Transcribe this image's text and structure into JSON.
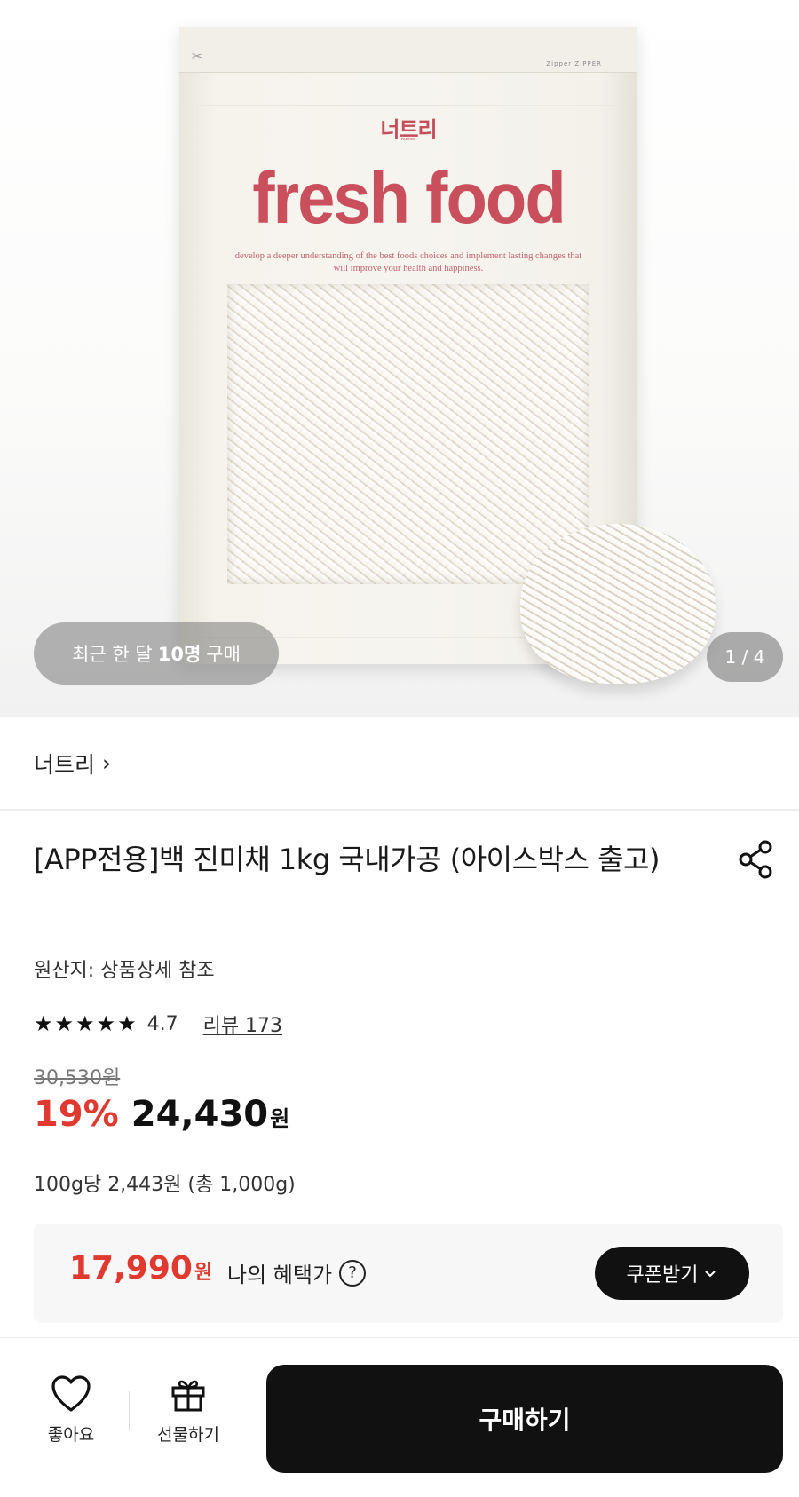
{
  "hero": {
    "brand_logo": "너트리",
    "brand_logo_sub": "nutree",
    "bag_zip_text": "Zipper ZIPPER",
    "bag_title": "fresh food",
    "bag_tagline": "develop a deeper understanding of the best foods choices and implement lasting changes that will improve your health and happiness.",
    "recent_prefix": "최근 한 달",
    "recent_count": "10명",
    "recent_suffix": "구매",
    "page_indicator": "1 / 4"
  },
  "brand": {
    "name": "너트리",
    "chevron": "›"
  },
  "product": {
    "title": "[APP전용]백 진미채 1kg 국내가공 (아이스박스 출고)",
    "origin": "원산지: 상품상세 참조",
    "rating": "4.7",
    "rating_stars": 4.7,
    "stars_text": "★★★★★",
    "review_link": "리뷰 173",
    "original_price": "30,530원",
    "discount": "19%",
    "price": "24,430",
    "price_unit": "원",
    "unit_price": "100g당 2,443원 (총 1,000g)"
  },
  "benefit": {
    "price": "17,990",
    "price_unit": "원",
    "label": "나의 혜택가",
    "help": "?",
    "coupon_label": "쿠폰받기",
    "coupon_chevron": "⌄"
  },
  "bottom": {
    "like_label": "좋아요",
    "gift_label": "선물하기",
    "buy_label": "구매하기"
  },
  "colors": {
    "accent_red": "#e0392f",
    "button_black": "#111111",
    "bag_pink": "#c94f5d"
  },
  "icons": [
    "scissors-icon",
    "share-icon",
    "star-icon",
    "help-icon",
    "chevron-down-icon",
    "heart-icon",
    "gift-icon"
  ]
}
